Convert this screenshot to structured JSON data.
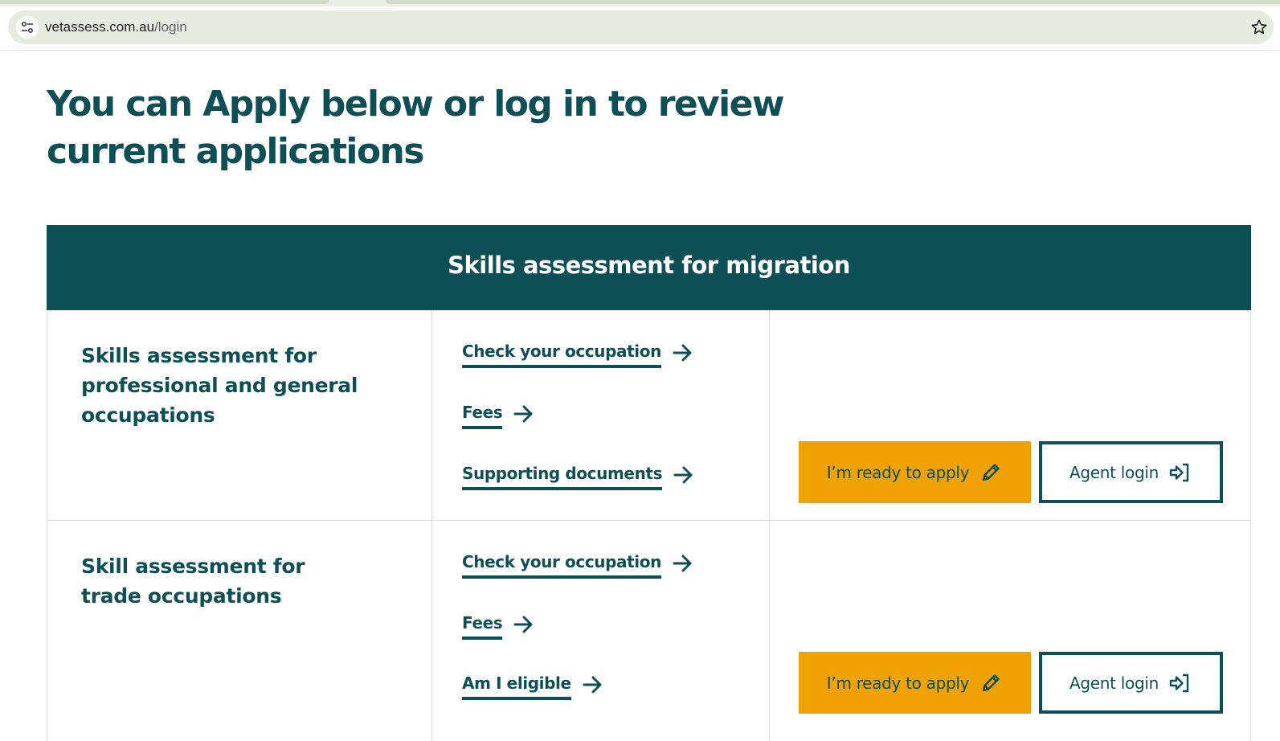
{
  "browser": {
    "url_host": "vetassess.com.au",
    "url_path": "/login"
  },
  "page": {
    "title": "You can Apply below or log in to review current applications"
  },
  "card": {
    "header": "Skills assessment for migration",
    "rows": [
      {
        "title": "Skills assessment for professional and general occupations",
        "links": [
          "Check your occupation",
          "Fees",
          "Supporting documents"
        ],
        "apply_label": "I’m ready to apply",
        "agent_label": "Agent login"
      },
      {
        "title": "Skill assessment for trade occupations",
        "links": [
          "Check your occupation",
          "Fees",
          "Am I eligible"
        ],
        "apply_label": "I’m ready to apply",
        "agent_label": "Agent login"
      }
    ]
  },
  "icons": {
    "site_info": "tune-icon",
    "bookmark": "star-icon",
    "link_arrow": "arrow-right-icon",
    "apply": "pencil-icon",
    "agent": "login-icon"
  },
  "colors": {
    "brand_teal": "#0e4f55",
    "apply_yellow": "#f0a202",
    "omnibox_bg": "#e4ede0"
  }
}
